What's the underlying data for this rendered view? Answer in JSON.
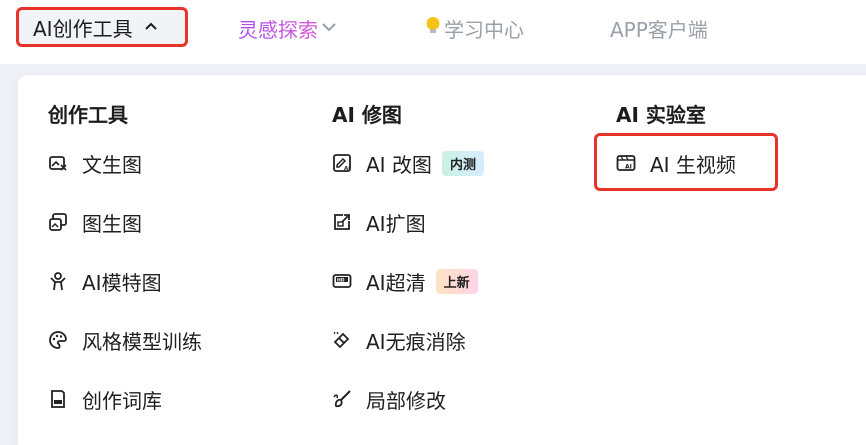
{
  "nav": {
    "tools_label": "AI创作工具",
    "tools_chevron": "^",
    "inspire_label": "灵感探索",
    "learn_label": "学习中心",
    "app_label": "APP客户端"
  },
  "menu": {
    "col1": {
      "title": "创作工具",
      "items": [
        {
          "label": "文生图",
          "icon": "text-to-image-icon"
        },
        {
          "label": "图生图",
          "icon": "image-to-image-icon"
        },
        {
          "label": "AI模特图",
          "icon": "model-figure-icon"
        },
        {
          "label": "风格模型训练",
          "icon": "palette-icon"
        },
        {
          "label": "创作词库",
          "icon": "lexicon-icon"
        }
      ]
    },
    "col2": {
      "title": "AI 修图",
      "items": [
        {
          "label": "AI 改图",
          "icon": "ai-edit-image-icon",
          "badge": "内测"
        },
        {
          "label": "AI扩图",
          "icon": "expand-image-icon"
        },
        {
          "label": "AI超清",
          "icon": "hd-ultra-icon",
          "badge": "上新"
        },
        {
          "label": "AI无痕消除",
          "icon": "eraser-icon"
        },
        {
          "label": "局部修改",
          "icon": "brush-icon"
        }
      ]
    },
    "col3": {
      "title": "AI 实验室",
      "items": [
        {
          "label": "AI 生视频",
          "icon": "ai-video-icon"
        }
      ]
    }
  },
  "colors": {
    "highlight": "#e8322a",
    "inspire_gradient_start": "#a84cf0",
    "inspire_gradient_end": "#e05fd0",
    "muted_text": "#9aa0a8"
  }
}
